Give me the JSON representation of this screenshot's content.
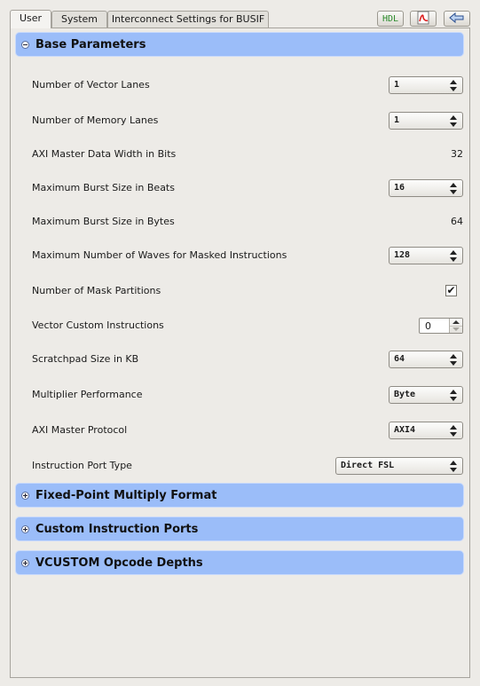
{
  "tabs": [
    {
      "label": "User",
      "active": true
    },
    {
      "label": "System",
      "active": false
    },
    {
      "label": "Interconnect Settings for BUSIF",
      "active": false
    }
  ],
  "toolbar": {
    "hdl_label": "HDL",
    "pdf_icon": "pdf-document-icon",
    "back_icon": "back-arrow-icon"
  },
  "sections": {
    "base": {
      "title": "Base Parameters",
      "expanded": true
    },
    "fixed_point": {
      "title": "Fixed-Point Multiply Format",
      "expanded": false
    },
    "custom_ports": {
      "title": "Custom Instruction Ports",
      "expanded": false
    },
    "vcustom": {
      "title": "VCUSTOM Opcode Depths",
      "expanded": false
    }
  },
  "params": {
    "vector_lanes": {
      "label": "Number of Vector Lanes",
      "value": "1"
    },
    "memory_lanes": {
      "label": "Number of Memory Lanes",
      "value": "1"
    },
    "axi_data_width": {
      "label": "AXI Master Data Width in Bits",
      "value": "32"
    },
    "burst_beats": {
      "label": "Maximum Burst Size in Beats",
      "value": "16"
    },
    "burst_bytes": {
      "label": "Maximum Burst Size in Bytes",
      "value": "64"
    },
    "max_waves": {
      "label": "Maximum Number of Waves for Masked Instructions",
      "value": "128"
    },
    "mask_partitions": {
      "label": "Number of Mask Partitions",
      "checked": true,
      "check_glyph": "✔"
    },
    "vector_custom": {
      "label": "Vector Custom Instructions",
      "value": "0"
    },
    "scratchpad": {
      "label": "Scratchpad Size in KB",
      "value": "64"
    },
    "multiplier_perf": {
      "label": "Multiplier Performance",
      "value": "Byte"
    },
    "axi_protocol": {
      "label": "AXI Master Protocol",
      "value": "AXI4"
    },
    "instr_port_type": {
      "label": "Instruction Port Type",
      "value": "Direct FSL"
    }
  },
  "colors": {
    "section_header": "#9bbdf9",
    "background": "#edebe7"
  }
}
